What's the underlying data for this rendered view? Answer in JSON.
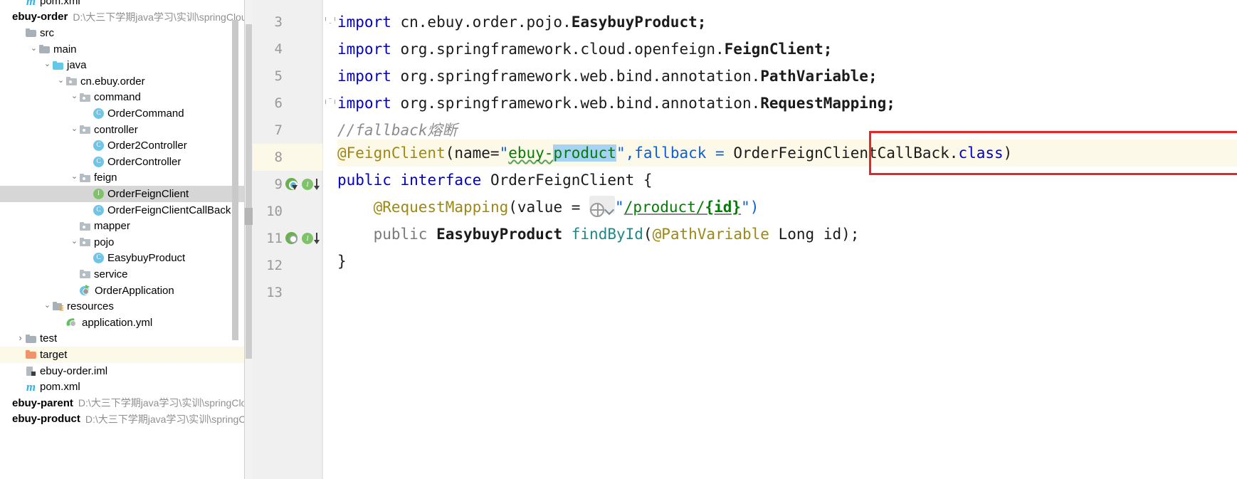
{
  "project_tree": {
    "rows": [
      {
        "id": "pom-xml-top",
        "label": "pom.xml",
        "icon": "maven-icon",
        "depth": 1,
        "twisty": "none",
        "kind": "file",
        "state": "normal"
      },
      {
        "id": "module-ebuy-order",
        "label": "ebuy-order",
        "path": "D:\\大三下学期java学习\\实训\\springClou",
        "icon": "module-icon",
        "depth": 0,
        "twisty": "none",
        "kind": "module",
        "state": "normal"
      },
      {
        "id": "src",
        "label": "src",
        "icon": "folder-icon",
        "depth": 1,
        "twisty": "none",
        "kind": "folder",
        "state": "normal"
      },
      {
        "id": "main",
        "label": "main",
        "icon": "folder-icon",
        "depth": 2,
        "twisty": "open",
        "kind": "folder",
        "state": "normal"
      },
      {
        "id": "java",
        "label": "java",
        "icon": "folder-source-icon",
        "depth": 3,
        "twisty": "open",
        "kind": "folder-blue",
        "state": "normal"
      },
      {
        "id": "cn-ebuy-order",
        "label": "cn.ebuy.order",
        "icon": "package-icon",
        "depth": 4,
        "twisty": "open",
        "kind": "package",
        "state": "normal"
      },
      {
        "id": "command",
        "label": "command",
        "icon": "package-icon",
        "depth": 5,
        "twisty": "open",
        "kind": "package",
        "state": "normal"
      },
      {
        "id": "OrderCommand",
        "label": "OrderCommand",
        "icon": "java-class-icon",
        "depth": 6,
        "twisty": "none",
        "kind": "class",
        "state": "normal"
      },
      {
        "id": "controller",
        "label": "controller",
        "icon": "package-icon",
        "depth": 5,
        "twisty": "open",
        "kind": "package",
        "state": "normal"
      },
      {
        "id": "Order2Controller",
        "label": "Order2Controller",
        "icon": "java-class-icon",
        "depth": 6,
        "twisty": "none",
        "kind": "class",
        "state": "normal"
      },
      {
        "id": "OrderController",
        "label": "OrderController",
        "icon": "java-class-icon",
        "depth": 6,
        "twisty": "none",
        "kind": "class",
        "state": "normal"
      },
      {
        "id": "feign",
        "label": "feign",
        "icon": "package-icon",
        "depth": 5,
        "twisty": "open",
        "kind": "package",
        "state": "normal"
      },
      {
        "id": "OrderFeignClient",
        "label": "OrderFeignClient",
        "icon": "java-interface-icon",
        "depth": 6,
        "twisty": "none",
        "kind": "interface",
        "state": "selected"
      },
      {
        "id": "OrderFeignClientCallBack",
        "label": "OrderFeignClientCallBack",
        "icon": "java-class-icon",
        "depth": 6,
        "twisty": "none",
        "kind": "class",
        "state": "normal"
      },
      {
        "id": "mapper",
        "label": "mapper",
        "icon": "package-icon",
        "depth": 5,
        "twisty": "none",
        "kind": "package",
        "state": "normal"
      },
      {
        "id": "pojo",
        "label": "pojo",
        "icon": "package-icon",
        "depth": 5,
        "twisty": "open",
        "kind": "package",
        "state": "normal"
      },
      {
        "id": "EasybuyProduct",
        "label": "EasybuyProduct",
        "icon": "java-class-icon",
        "depth": 6,
        "twisty": "none",
        "kind": "class",
        "state": "normal"
      },
      {
        "id": "service",
        "label": "service",
        "icon": "package-icon",
        "depth": 5,
        "twisty": "none",
        "kind": "package",
        "state": "normal"
      },
      {
        "id": "OrderApplication",
        "label": "OrderApplication",
        "icon": "spring-boot-app-icon",
        "depth": 5,
        "twisty": "none",
        "kind": "boot",
        "state": "normal"
      },
      {
        "id": "resources",
        "label": "resources",
        "icon": "resources-folder-icon",
        "depth": 3,
        "twisty": "open",
        "kind": "resources",
        "state": "normal"
      },
      {
        "id": "application-yml",
        "label": "application.yml",
        "icon": "spring-yaml-icon",
        "depth": 4,
        "twisty": "none",
        "kind": "yml",
        "state": "normal"
      },
      {
        "id": "test",
        "label": "test",
        "icon": "folder-icon",
        "depth": 1,
        "twisty": "closed",
        "kind": "folder",
        "state": "normal"
      },
      {
        "id": "target",
        "label": "target",
        "icon": "folder-excluded-icon",
        "depth": 1,
        "twisty": "none",
        "kind": "folder-orange",
        "state": "marked"
      },
      {
        "id": "ebuy-order-iml",
        "label": "ebuy-order.iml",
        "icon": "module-file-icon",
        "depth": 1,
        "twisty": "none",
        "kind": "iml",
        "state": "normal"
      },
      {
        "id": "pom-xml-bottom",
        "label": "pom.xml",
        "icon": "maven-icon",
        "depth": 1,
        "twisty": "none",
        "kind": "file",
        "state": "normal"
      },
      {
        "id": "module-ebuy-parent",
        "label": "ebuy-parent",
        "path": "D:\\大三下学期java学习\\实训\\springClou",
        "icon": "module-icon",
        "depth": 0,
        "twisty": "none",
        "kind": "module",
        "state": "normal"
      },
      {
        "id": "module-ebuy-product",
        "label": "ebuy-product",
        "path": "D:\\大三下学期java学习\\实训\\springClo",
        "icon": "module-icon",
        "depth": 0,
        "twisty": "none",
        "kind": "module",
        "state": "normal"
      }
    ],
    "selected_item": "OrderFeignClient",
    "scrollbar": {
      "name": "tree-vertical-scrollbar",
      "visible": true
    }
  },
  "editor": {
    "current_line": 8,
    "selection_text": "product",
    "gutter_icons": {
      "line9": [
        "spring-bean-icon",
        "interface-implemented-icon",
        "down-arrow-icon"
      ],
      "line11": [
        "spring-bean-icon",
        "interface-implemented-icon",
        "down-arrow-icon"
      ],
      "iface_letter": "I"
    },
    "lines": [
      {
        "n": "3",
        "fold": "fold-bot"
      },
      {
        "n": "4",
        "fold": ""
      },
      {
        "n": "5",
        "fold": ""
      },
      {
        "n": "6",
        "fold": "fold-top"
      },
      {
        "n": "7",
        "fold": ""
      },
      {
        "n": "8",
        "fold": ""
      },
      {
        "n": "9",
        "fold": ""
      },
      {
        "n": "10",
        "fold": ""
      },
      {
        "n": "11",
        "fold": ""
      },
      {
        "n": "12",
        "fold": ""
      },
      {
        "n": "13",
        "fold": ""
      }
    ],
    "code": {
      "l3": "import cn.ebuy.order.pojo.EasybuyProduct;",
      "l4": "import org.springframework.cloud.openfeign.FeignClient;",
      "l5": "import org.springframework.web.bind.annotation.PathVariable;",
      "l6": "import org.springframework.web.bind.annotation.RequestMapping;",
      "l7": "//fallback熔断",
      "l8": "@FeignClient(name=\"ebuy-product\",fallback = OrderFeignClientCallBack.class)",
      "l9": "public interface OrderFeignClient {",
      "l10": "    @RequestMapping(value = \"/product/{id}\")",
      "l11": "    public EasybuyProduct findById(@PathVariable Long id);",
      "l12": "}",
      "l13": "",
      "tok": {
        "import": "import",
        "cn_pkg": " cn.ebuy.order.pojo.",
        "EasybuyProduct_semi": "EasybuyProduct;",
        "org_cloud": " org.springframework.cloud.openfeign.",
        "FeignClient_semi": "FeignClient;",
        "org_web": " org.springframework.web.bind.annotation.",
        "PathVariable_semi": "PathVariable;",
        "RequestMapping_semi": "RequestMapping;",
        "comment7": "//fallback熔断",
        "anno_feignclient": "@FeignClient",
        "paren_name": "(name=",
        "quote": "\"",
        "ebuy_dash": "ebuy-",
        "product": "product",
        "quote_comma_fallback": "\",fallback = ",
        "OrderFeignClientCallBack": "OrderFeignClientCallBack",
        "dot": ".",
        "class_kw": "class",
        "rparen": ")",
        "public": "public",
        "interface": "interface",
        "OrderFeignClient": "OrderFeignClient",
        "lbrace": "{",
        "rbrace": "}",
        "indent4": "    ",
        "anno_requestmapping": "@RequestMapping",
        "paren_value": "(value = ",
        "url_product": "/product/",
        "url_id": "{id}",
        "quote_rparen": "\")",
        "EasybuyProduct": "EasybuyProduct",
        "findById": "findById",
        "lparen": "(",
        "anno_pathvariable": "@PathVariable",
        "Long": " Long",
        "id_semi": " id);"
      }
    },
    "annotation_box": {
      "name": "red-highlight-rectangle",
      "color": "#ee2222"
    }
  },
  "colors": {
    "selection_blue": "#a6d2f4",
    "current_line_yellow": "#fcf9e8",
    "tree_selection_grey": "#d6d6d6",
    "keyword_blue": "#0000c8",
    "annotation_olive": "#9e8813",
    "string_green": "#047d04",
    "comment_grey": "#8c8c8c",
    "method_teal": "#1b8a8a",
    "red_box": "#ee2222"
  }
}
